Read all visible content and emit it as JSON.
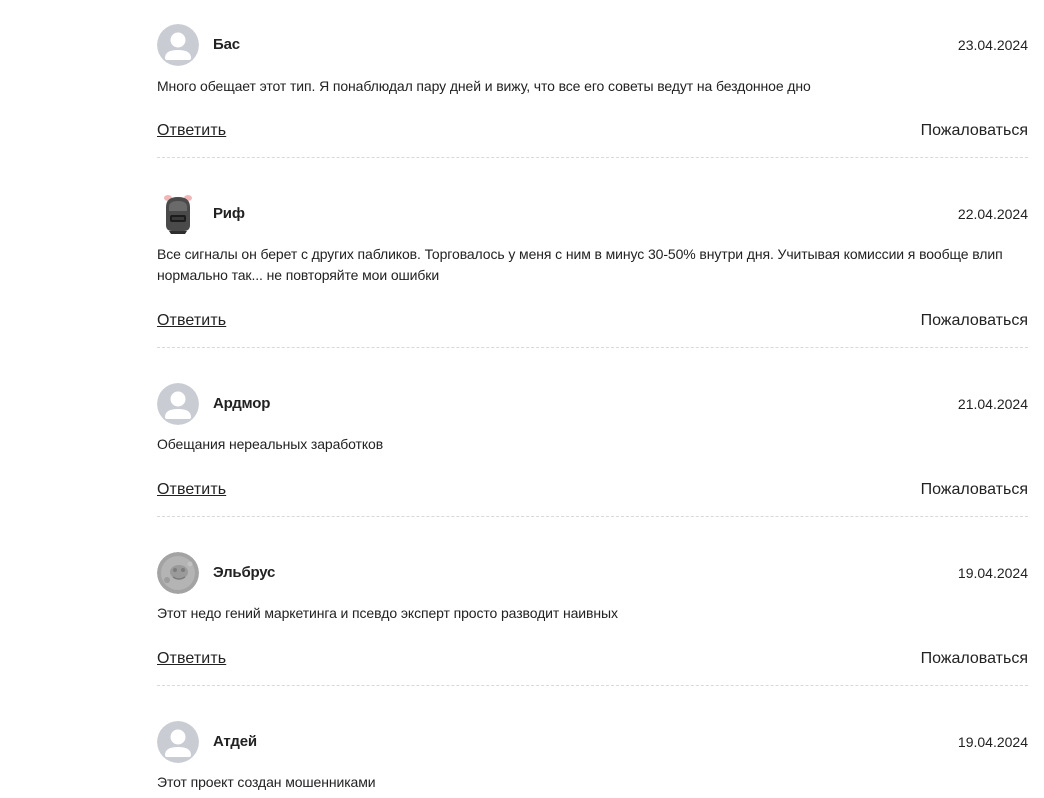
{
  "actions": {
    "reply_label": "Ответить",
    "report_label": "Пожаловаться"
  },
  "comments": [
    {
      "author": "Бас",
      "date": "23.04.2024",
      "text": "Много обещает этот тип. Я понаблюдал пару дней и вижу, что все его советы ведут на бездонное дно",
      "avatar": "default-user-icon"
    },
    {
      "author": "Риф",
      "date": "22.04.2024",
      "text": "Все сигналы он берет с других пабликов. Торговалось у меня с ним в минус 30-50% внутри дня. Учитывая комиссии я вообще влип нормально так... не повторяйте мои ошибки",
      "avatar": "helmet-avatar-icon"
    },
    {
      "author": "Ардмор",
      "date": "21.04.2024",
      "text": "Обещания нереальных заработков",
      "avatar": "default-user-icon"
    },
    {
      "author": "Эльбрус",
      "date": "19.04.2024",
      "text": "Этот недо гений маркетинга и псевдо эксперт просто разводит наивных",
      "avatar": "gray-photo-avatar-icon"
    },
    {
      "author": "Атдей",
      "date": "19.04.2024",
      "text": "Этот проект создан мошенниками",
      "avatar": "default-user-icon"
    }
  ],
  "colors": {
    "text": "#222222",
    "avatar_bg": "#c9ccd3",
    "divider": "#d9d9d9"
  }
}
